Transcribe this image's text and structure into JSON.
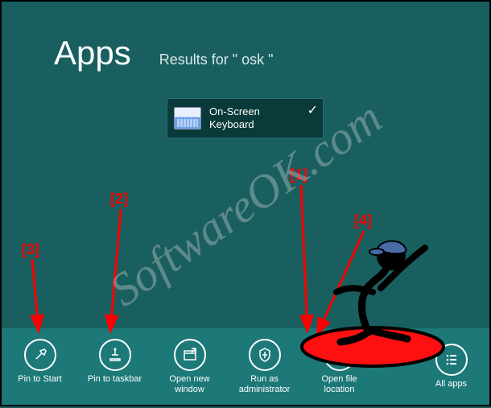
{
  "header": {
    "title": "Apps",
    "results_label": "Results for \" osk \""
  },
  "tile": {
    "line1": "On-Screen",
    "line2": "Keyboard"
  },
  "appbar": {
    "buttons": [
      {
        "id": "pin-start",
        "label": "Pin to Start"
      },
      {
        "id": "pin-taskbar",
        "label": "Pin to taskbar"
      },
      {
        "id": "open-new-window",
        "label": "Open new window"
      },
      {
        "id": "run-as-admin",
        "label": "Run as administrator"
      },
      {
        "id": "open-file-location",
        "label": "Open file location"
      }
    ],
    "all_apps_label": "All apps"
  },
  "annotations": {
    "a1": "[1]",
    "a2": "[2]",
    "a3": "[3]",
    "a4": "[4]"
  },
  "watermark": "SoftwareOK.com"
}
